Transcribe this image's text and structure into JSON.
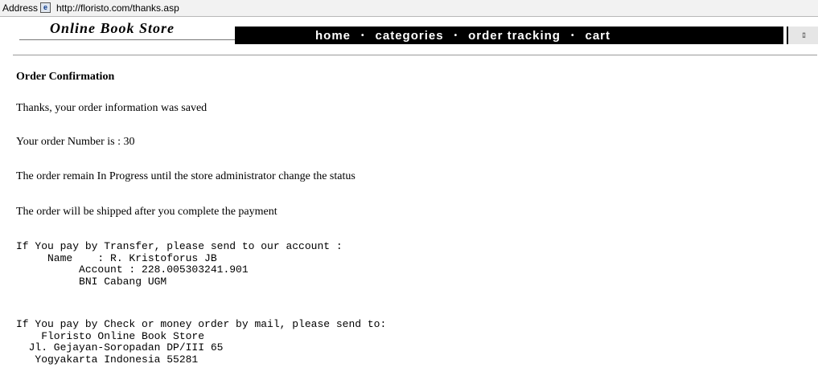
{
  "browser": {
    "address_label": "Address",
    "url": "http://floristo.com/thanks.asp"
  },
  "site": {
    "logo_text": "Online Book Store",
    "nav": {
      "home": "home",
      "categories": "categories",
      "order_tracking": "order tracking",
      "cart": "cart",
      "separator": "•"
    }
  },
  "page": {
    "heading": "Order Confirmation",
    "saved_message": "Thanks, your order information was saved",
    "order_number_line": "Your order Number is : 30",
    "status_message": "The order remain In Progress until the store administrator change the status",
    "shipping_message": "The order will be shipped after you complete the payment",
    "transfer": {
      "intro": "If You pay by Transfer, please send to our account :",
      "name_line": "     Name    : R. Kristoforus JB",
      "account_line": "          Account : 228.005303241.901",
      "bank_line": "          BNI Cabang UGM"
    },
    "check": {
      "intro": "If You pay by Check or money order by mail, please send to:",
      "store_line": "    Floristo Online Book Store",
      "street_line": "  Jl. Gejayan-Soropadan DP/III 65",
      "city_line": "   Yogyakarta Indonesia 55281"
    }
  }
}
